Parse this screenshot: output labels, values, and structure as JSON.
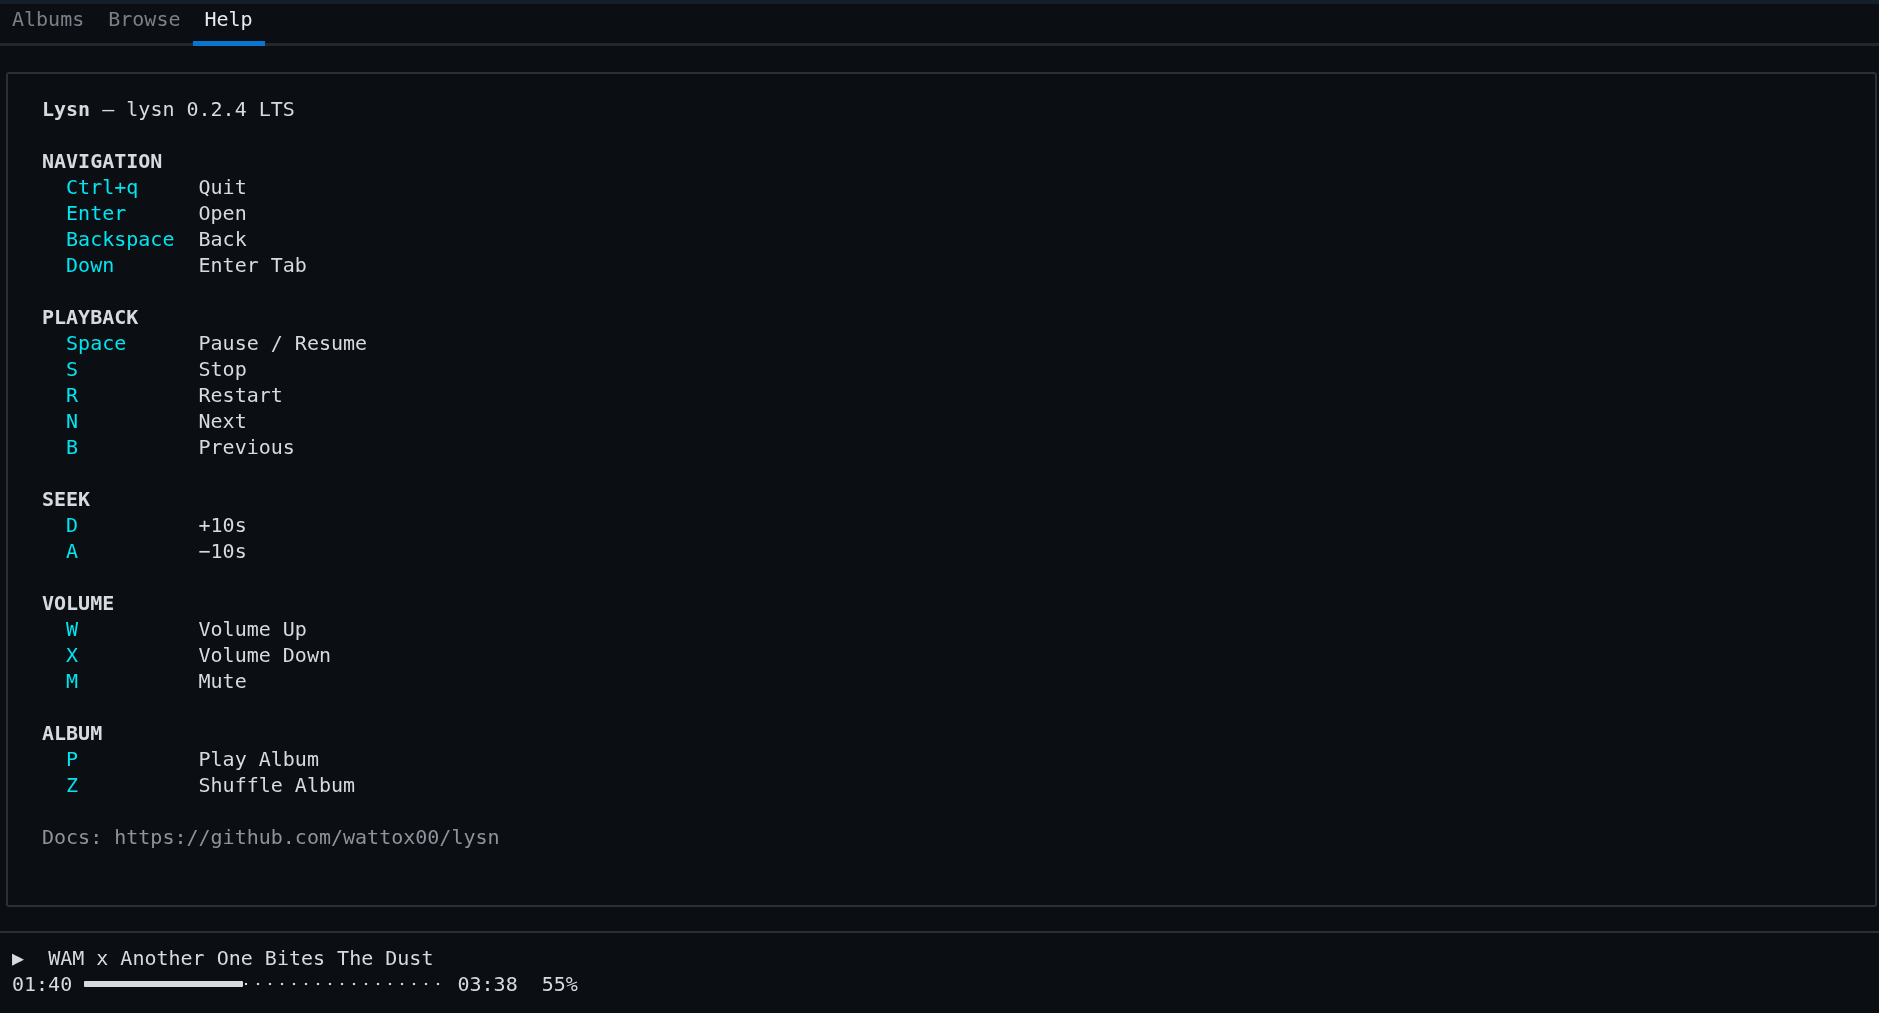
{
  "tabs": [
    {
      "label": "Albums",
      "selected": false
    },
    {
      "label": "Browse",
      "selected": false
    },
    {
      "label": "Help",
      "selected": true
    }
  ],
  "help": {
    "title": "**Lysn** — lysn 0.2.4 LTS",
    "sections": [
      {
        "heading": "NAVIGATION",
        "bindings": [
          {
            "key": "Ctrl+q",
            "action": "Quit"
          },
          {
            "key": "Enter",
            "action": "Open"
          },
          {
            "key": "Backspace",
            "action": "Back"
          },
          {
            "key": "Down",
            "action": "Enter Tab"
          }
        ]
      },
      {
        "heading": "PLAYBACK",
        "bindings": [
          {
            "key": "Space",
            "action": "Pause / Resume"
          },
          {
            "key": "S",
            "action": "Stop"
          },
          {
            "key": "R",
            "action": "Restart"
          },
          {
            "key": "N",
            "action": "Next"
          },
          {
            "key": "B",
            "action": "Previous"
          }
        ]
      },
      {
        "heading": "SEEK",
        "bindings": [
          {
            "key": "D",
            "action": "+10s"
          },
          {
            "key": "A",
            "action": "−10s"
          }
        ]
      },
      {
        "heading": "VOLUME",
        "bindings": [
          {
            "key": "W",
            "action": "Volume Up"
          },
          {
            "key": "X",
            "action": "Volume Down"
          },
          {
            "key": "M",
            "action": "Mute"
          }
        ]
      },
      {
        "heading": "ALBUM",
        "bindings": [
          {
            "key": "P",
            "action": "Play Album"
          },
          {
            "key": "Z",
            "action": "Shuffle Album"
          }
        ]
      }
    ],
    "docs": "Docs: https://github.com/wattox00/lysn"
  },
  "player": {
    "status_icon": "▶",
    "track": "WAM x Another One Bites The Dust",
    "elapsed": "01:40",
    "progress": {
      "level": 0.44
    },
    "duration": "03:38",
    "volume": "55%"
  }
}
